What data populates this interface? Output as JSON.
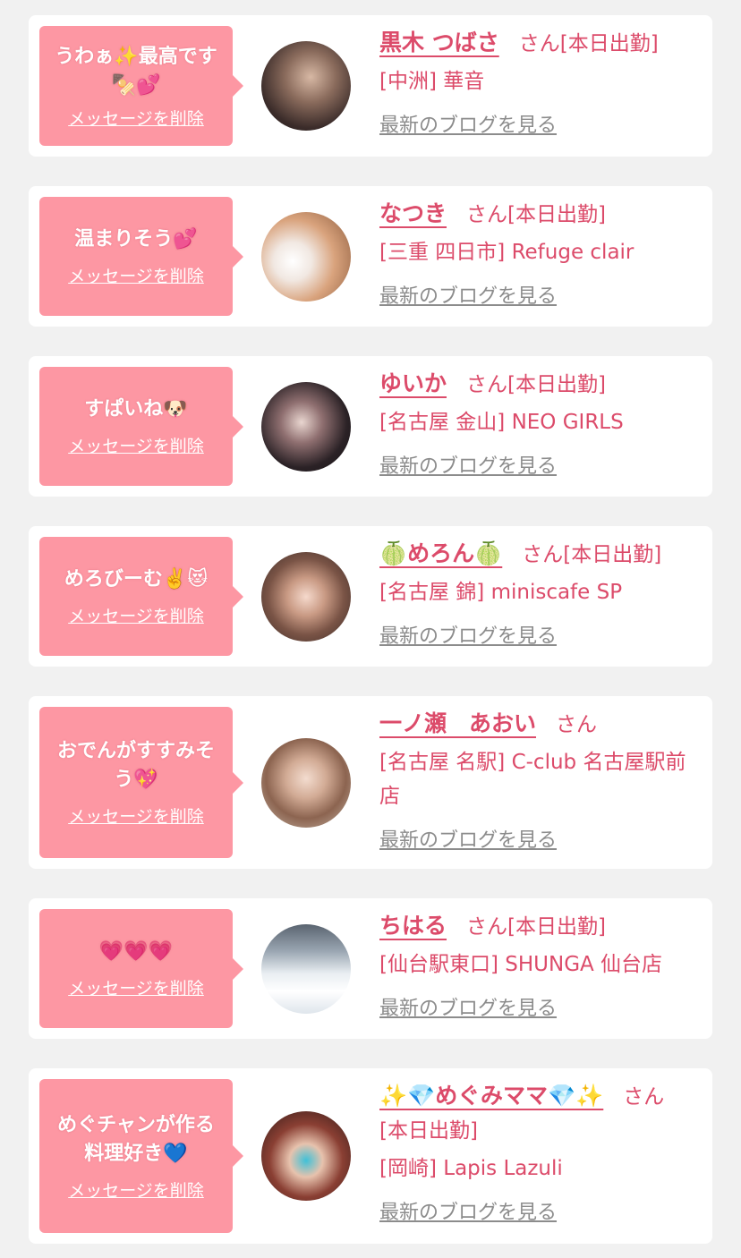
{
  "delete_label": "メッセージを削除",
  "blog_label": "最新のブログを見る",
  "san_label": "さん",
  "colors": {
    "page_bg": "#f1f1f1",
    "bubble": "#fd97a3",
    "accent": "#dc4b6a",
    "muted_link": "#8c8c8c"
  },
  "entries": [
    {
      "message": "うわぁ✨最高です🍢💕",
      "name": "黒木 つばさ",
      "status": "[本日出勤]",
      "shop": "[中洲] 華音"
    },
    {
      "message": "温まりそう💕",
      "name": "なつき",
      "status": "[本日出勤]",
      "shop": "[三重 四日市] Refuge clair"
    },
    {
      "message": "すぱいね🐶",
      "name": "ゆいか",
      "status": "[本日出勤]",
      "shop": "[名古屋 金山] NEO GIRLS"
    },
    {
      "message": "めろびーむ✌️😻",
      "name": "🍈めろん🍈",
      "status": "[本日出勤]",
      "shop": "[名古屋 錦] miniscafe SP"
    },
    {
      "message": "おでんがすすみそう💖",
      "name": "一ノ瀬　あおい",
      "status": "",
      "shop": "[名古屋 名駅] C-club 名古屋駅前店"
    },
    {
      "message": "💗💗💗",
      "name": "ちはる",
      "status": "[本日出勤]",
      "shop": "[仙台駅東口] SHUNGA 仙台店"
    },
    {
      "message": "めぐチャンが作る料理好き💙",
      "name": "✨💎めぐみママ💎✨",
      "status": "[本日出勤]",
      "shop": "[岡崎] Lapis Lazuli"
    }
  ]
}
